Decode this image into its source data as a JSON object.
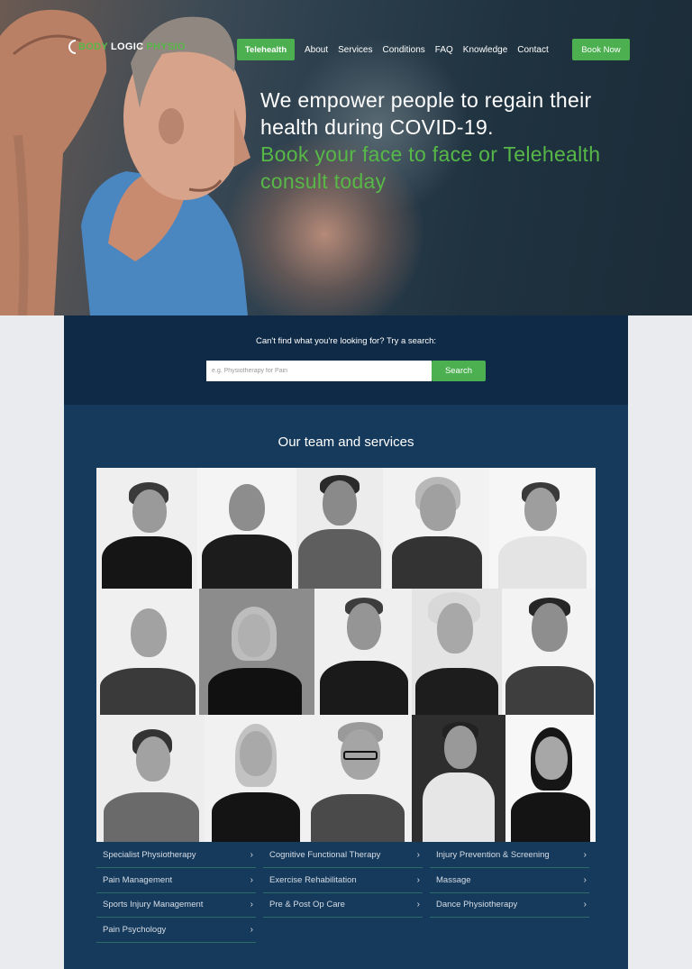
{
  "logo": {
    "part1": "BODY",
    "part2": "LOGIC",
    "part3": "PHYSIO"
  },
  "nav": {
    "telehealth": "Telehealth",
    "links": [
      "About",
      "Services",
      "Conditions",
      "FAQ",
      "Knowledge",
      "Contact"
    ],
    "book_now": "Book Now"
  },
  "hero": {
    "headline_white": "We empower people to regain their health during COVID-19.",
    "headline_green": "Book your face to face or Telehealth consult today"
  },
  "search": {
    "prompt": "Can't find what you're looking for? Try a search:",
    "placeholder": "e.g. Physiotherapy for Pain",
    "button": "Search"
  },
  "team": {
    "title": "Our team and services"
  },
  "services": {
    "col1": [
      "Specialist Physiotherapy",
      "Pain Management",
      "Sports Injury Management",
      "Pain Psychology"
    ],
    "col2": [
      "Cognitive Functional Therapy",
      "Exercise Rehabilitation",
      "Pre & Post Op Care"
    ],
    "col3": [
      "Injury Prevention & Screening",
      "Massage",
      "Dance Physiotherapy"
    ]
  },
  "colors": {
    "brand_green": "#4caf50",
    "navy": "#163a5c",
    "navy_dark": "#0f2a46"
  }
}
